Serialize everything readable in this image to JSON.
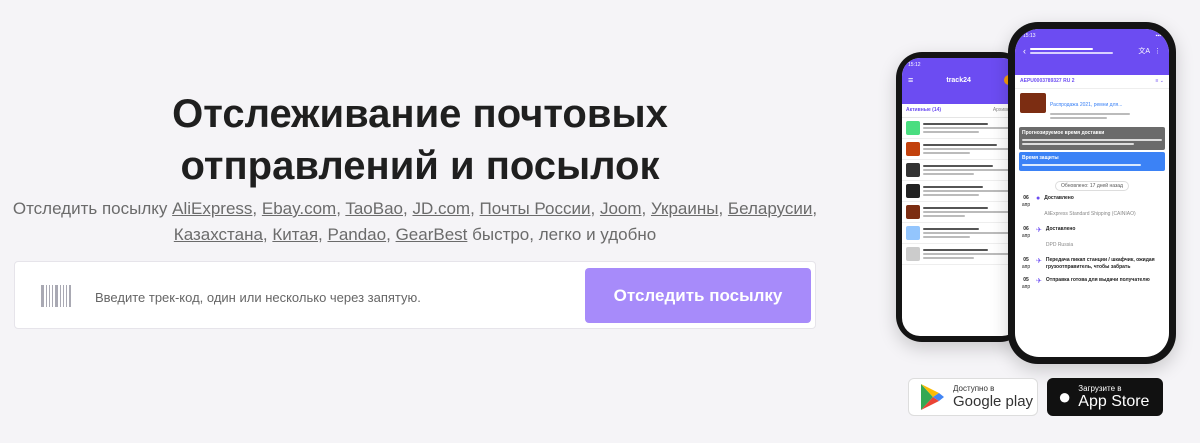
{
  "hero": {
    "title_line1": "Отслеживание почтовых",
    "title_line2": "отправлений и посылок",
    "subtitle_prefix": "Отследить посылку",
    "links": [
      "AliExpress",
      "Ebay.com",
      "TaoBao",
      "JD.com",
      "Почты России",
      "Joom",
      "Украины",
      "Беларусии",
      "Казахстана",
      "Китая",
      "Pandao",
      "GearBest"
    ],
    "subtitle_suffix": "быстро, легко и удобно"
  },
  "tracking": {
    "placeholder": "Введите трек-код, один или несколько через запятую.",
    "button_label": "Отследить посылку"
  },
  "app_back": {
    "time": "15:12",
    "logo": "track24",
    "tab_active": "Активные (14)",
    "tab_other": "Архивные"
  },
  "app_front": {
    "time": "15:13",
    "track_code": "AEPU0003789327 RU 2",
    "item_title": "Распродажа 2021, ремни для...",
    "forecast_title": "Прогнозируемое время доставки",
    "protect_title": "Время защиты",
    "updated": "Обновлено: 17 дней назад",
    "events": [
      {
        "day": "06",
        "mon": "апр",
        "title": "Доставлено",
        "sub": "AliExpress Standard Shipping (CAINIAO)"
      },
      {
        "day": "06",
        "mon": "апр",
        "title": "Доставлено",
        "sub": "DPD Russia"
      },
      {
        "day": "05",
        "mon": "апр",
        "title": "Передача пикап станции / шкафчик, ожидая грузоотправитель, чтобы забрать",
        "sub": ""
      },
      {
        "day": "05",
        "mon": "апр",
        "title": "Отправка готова для выдачи получателю",
        "sub": ""
      }
    ]
  },
  "stores": {
    "google_small": "Доступно в",
    "google_big": "Google play",
    "apple_small": "Загрузите в",
    "apple_big": "App Store"
  },
  "colors": {
    "accent": "#a78bfa",
    "app_purple": "#6c4cf2"
  }
}
